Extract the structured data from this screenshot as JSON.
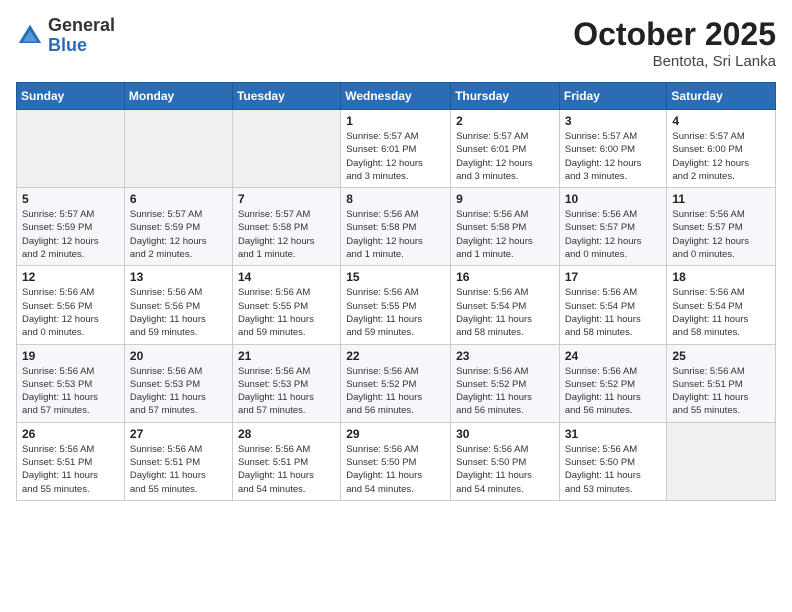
{
  "logo": {
    "general": "General",
    "blue": "Blue"
  },
  "title": "October 2025",
  "location": "Bentota, Sri Lanka",
  "headers": [
    "Sunday",
    "Monday",
    "Tuesday",
    "Wednesday",
    "Thursday",
    "Friday",
    "Saturday"
  ],
  "weeks": [
    [
      {
        "day": "",
        "info": ""
      },
      {
        "day": "",
        "info": ""
      },
      {
        "day": "",
        "info": ""
      },
      {
        "day": "1",
        "info": "Sunrise: 5:57 AM\nSunset: 6:01 PM\nDaylight: 12 hours\nand 3 minutes."
      },
      {
        "day": "2",
        "info": "Sunrise: 5:57 AM\nSunset: 6:01 PM\nDaylight: 12 hours\nand 3 minutes."
      },
      {
        "day": "3",
        "info": "Sunrise: 5:57 AM\nSunset: 6:00 PM\nDaylight: 12 hours\nand 3 minutes."
      },
      {
        "day": "4",
        "info": "Sunrise: 5:57 AM\nSunset: 6:00 PM\nDaylight: 12 hours\nand 2 minutes."
      }
    ],
    [
      {
        "day": "5",
        "info": "Sunrise: 5:57 AM\nSunset: 5:59 PM\nDaylight: 12 hours\nand 2 minutes."
      },
      {
        "day": "6",
        "info": "Sunrise: 5:57 AM\nSunset: 5:59 PM\nDaylight: 12 hours\nand 2 minutes."
      },
      {
        "day": "7",
        "info": "Sunrise: 5:57 AM\nSunset: 5:58 PM\nDaylight: 12 hours\nand 1 minute."
      },
      {
        "day": "8",
        "info": "Sunrise: 5:56 AM\nSunset: 5:58 PM\nDaylight: 12 hours\nand 1 minute."
      },
      {
        "day": "9",
        "info": "Sunrise: 5:56 AM\nSunset: 5:58 PM\nDaylight: 12 hours\nand 1 minute."
      },
      {
        "day": "10",
        "info": "Sunrise: 5:56 AM\nSunset: 5:57 PM\nDaylight: 12 hours\nand 0 minutes."
      },
      {
        "day": "11",
        "info": "Sunrise: 5:56 AM\nSunset: 5:57 PM\nDaylight: 12 hours\nand 0 minutes."
      }
    ],
    [
      {
        "day": "12",
        "info": "Sunrise: 5:56 AM\nSunset: 5:56 PM\nDaylight: 12 hours\nand 0 minutes."
      },
      {
        "day": "13",
        "info": "Sunrise: 5:56 AM\nSunset: 5:56 PM\nDaylight: 11 hours\nand 59 minutes."
      },
      {
        "day": "14",
        "info": "Sunrise: 5:56 AM\nSunset: 5:55 PM\nDaylight: 11 hours\nand 59 minutes."
      },
      {
        "day": "15",
        "info": "Sunrise: 5:56 AM\nSunset: 5:55 PM\nDaylight: 11 hours\nand 59 minutes."
      },
      {
        "day": "16",
        "info": "Sunrise: 5:56 AM\nSunset: 5:54 PM\nDaylight: 11 hours\nand 58 minutes."
      },
      {
        "day": "17",
        "info": "Sunrise: 5:56 AM\nSunset: 5:54 PM\nDaylight: 11 hours\nand 58 minutes."
      },
      {
        "day": "18",
        "info": "Sunrise: 5:56 AM\nSunset: 5:54 PM\nDaylight: 11 hours\nand 58 minutes."
      }
    ],
    [
      {
        "day": "19",
        "info": "Sunrise: 5:56 AM\nSunset: 5:53 PM\nDaylight: 11 hours\nand 57 minutes."
      },
      {
        "day": "20",
        "info": "Sunrise: 5:56 AM\nSunset: 5:53 PM\nDaylight: 11 hours\nand 57 minutes."
      },
      {
        "day": "21",
        "info": "Sunrise: 5:56 AM\nSunset: 5:53 PM\nDaylight: 11 hours\nand 57 minutes."
      },
      {
        "day": "22",
        "info": "Sunrise: 5:56 AM\nSunset: 5:52 PM\nDaylight: 11 hours\nand 56 minutes."
      },
      {
        "day": "23",
        "info": "Sunrise: 5:56 AM\nSunset: 5:52 PM\nDaylight: 11 hours\nand 56 minutes."
      },
      {
        "day": "24",
        "info": "Sunrise: 5:56 AM\nSunset: 5:52 PM\nDaylight: 11 hours\nand 56 minutes."
      },
      {
        "day": "25",
        "info": "Sunrise: 5:56 AM\nSunset: 5:51 PM\nDaylight: 11 hours\nand 55 minutes."
      }
    ],
    [
      {
        "day": "26",
        "info": "Sunrise: 5:56 AM\nSunset: 5:51 PM\nDaylight: 11 hours\nand 55 minutes."
      },
      {
        "day": "27",
        "info": "Sunrise: 5:56 AM\nSunset: 5:51 PM\nDaylight: 11 hours\nand 55 minutes."
      },
      {
        "day": "28",
        "info": "Sunrise: 5:56 AM\nSunset: 5:51 PM\nDaylight: 11 hours\nand 54 minutes."
      },
      {
        "day": "29",
        "info": "Sunrise: 5:56 AM\nSunset: 5:50 PM\nDaylight: 11 hours\nand 54 minutes."
      },
      {
        "day": "30",
        "info": "Sunrise: 5:56 AM\nSunset: 5:50 PM\nDaylight: 11 hours\nand 54 minutes."
      },
      {
        "day": "31",
        "info": "Sunrise: 5:56 AM\nSunset: 5:50 PM\nDaylight: 11 hours\nand 53 minutes."
      },
      {
        "day": "",
        "info": ""
      }
    ]
  ]
}
